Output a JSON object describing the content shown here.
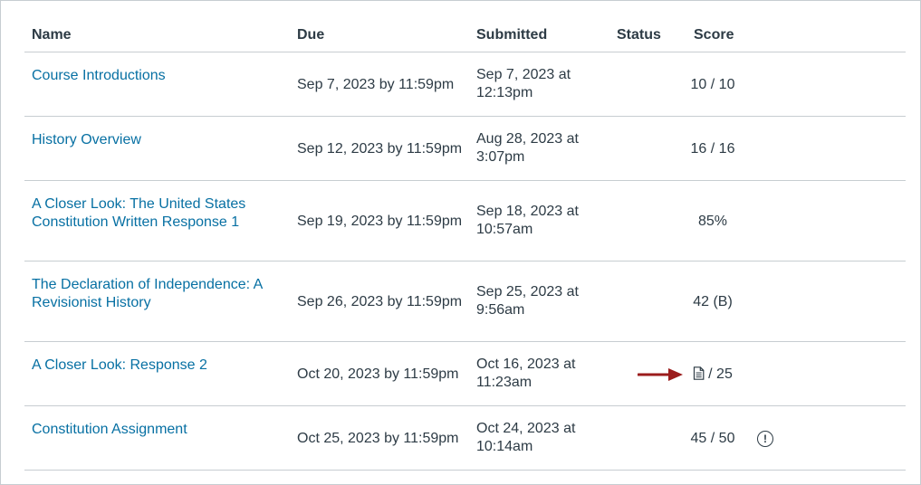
{
  "columns": {
    "name": "Name",
    "due": "Due",
    "submitted": "Submitted",
    "status": "Status",
    "score": "Score"
  },
  "rows": [
    {
      "name_lines": [
        "Course Introductions"
      ],
      "due": "Sep 7, 2023 by 11:59pm",
      "submitted_lines": [
        "Sep 7, 2023 at",
        "12:13pm"
      ],
      "score": "10 / 10"
    },
    {
      "name_lines": [
        "History Overview"
      ],
      "due": "Sep 12, 2023 by 11:59pm",
      "submitted_lines": [
        "Aug 28, 2023 at",
        "3:07pm"
      ],
      "score": "16 / 16"
    },
    {
      "name_lines": [
        "A Closer Look: The United States",
        "Constitution Written Response 1"
      ],
      "due": "Sep 19, 2023 by 11:59pm",
      "submitted_lines": [
        "Sep 18, 2023 at",
        "10:57am"
      ],
      "score": "85%"
    },
    {
      "name_lines": [
        "The Declaration of Independence: A",
        "Revisionist History"
      ],
      "due": "Sep 26, 2023 by 11:59pm",
      "submitted_lines": [
        "Sep 25, 2023 at",
        "9:56am"
      ],
      "score": "42 (B)"
    },
    {
      "name_lines": [
        "A Closer Look: Response 2"
      ],
      "due": "Oct 20, 2023 by 11:59pm",
      "submitted_lines": [
        "Oct 16, 2023 at",
        "11:23am"
      ],
      "score": "/ 25",
      "score_icon": "document-icon",
      "annotation": "red-arrow-pointer"
    },
    {
      "name_lines": [
        "Constitution Assignment"
      ],
      "due": "Oct 25, 2023 by 11:59pm",
      "submitted_lines": [
        "Oct 24, 2023 at",
        "10:14am"
      ],
      "score": "45 / 50",
      "trailing_icon": "alert-circle-icon",
      "trailing_icon_glyph": "!"
    }
  ],
  "colors": {
    "link": "#0770a3",
    "text": "#2d3b45",
    "divider": "#c7cdd1",
    "arrow": "#9b1c1c"
  }
}
